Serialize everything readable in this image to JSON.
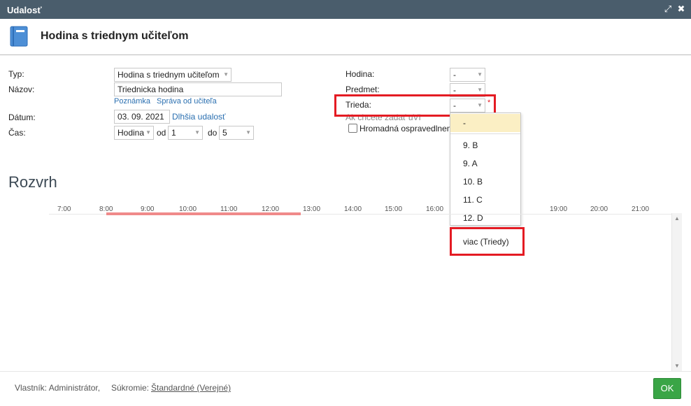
{
  "window": {
    "title": "Udalosť",
    "expand_icon": "expand-icon",
    "close_icon": "close-icon"
  },
  "header": {
    "title": "Hodina s triednym učiteľom",
    "icon": "book-icon"
  },
  "form": {
    "typ_label": "Typ:",
    "typ_value": "Hodina s triednym učiteľom",
    "nazov_label": "Názov:",
    "nazov_value": "Triednicka hodina",
    "poznamka_link": "Poznámka",
    "sprava_link": "Správa od učiteľa",
    "datum_label": "Dátum:",
    "datum_value": "03. 09. 2021",
    "dlhsia_link": "Dlhšia udalosť",
    "cas_label": "Čas:",
    "cas_unit": "Hodina",
    "od_label": "od",
    "od_value": "1",
    "do_label": "do",
    "do_value": "5",
    "hodina_label": "Hodina:",
    "hodina_value": "-",
    "predmet_label": "Predmet:",
    "predmet_value": "-",
    "trieda_label": "Trieda:",
    "trieda_value": "-",
    "required_mark": "*",
    "hint_text": "Ak chcete zadať uVI",
    "hromadna_label": "Hromadná ospravedlnen"
  },
  "trieda_dropdown": {
    "options": [
      "-",
      "9. B",
      "9. A",
      "10. B",
      "11. C",
      "12. D",
      "viac (Triedy)"
    ],
    "selected": "-"
  },
  "rozvrh": {
    "title": "Rozvrh",
    "hours": [
      "7:00",
      "8:00",
      "9:00",
      "10:00",
      "11:00",
      "12:00",
      "13:00",
      "14:00",
      "15:00",
      "16:00",
      "19:00",
      "20:00",
      "21:00"
    ]
  },
  "footer": {
    "owner": "Vlastník: Administrátor,",
    "privacy_label": "Súkromie:",
    "privacy_value": "Štandardné (Verejné)",
    "ok_label": "OK"
  },
  "colors": {
    "titlebar": "#4a5d6c",
    "highlight_box": "#e41b23",
    "timeline_bar": "#f08a8a",
    "ok_button": "#3aa546",
    "dropdown_selected": "#fbefc4"
  }
}
